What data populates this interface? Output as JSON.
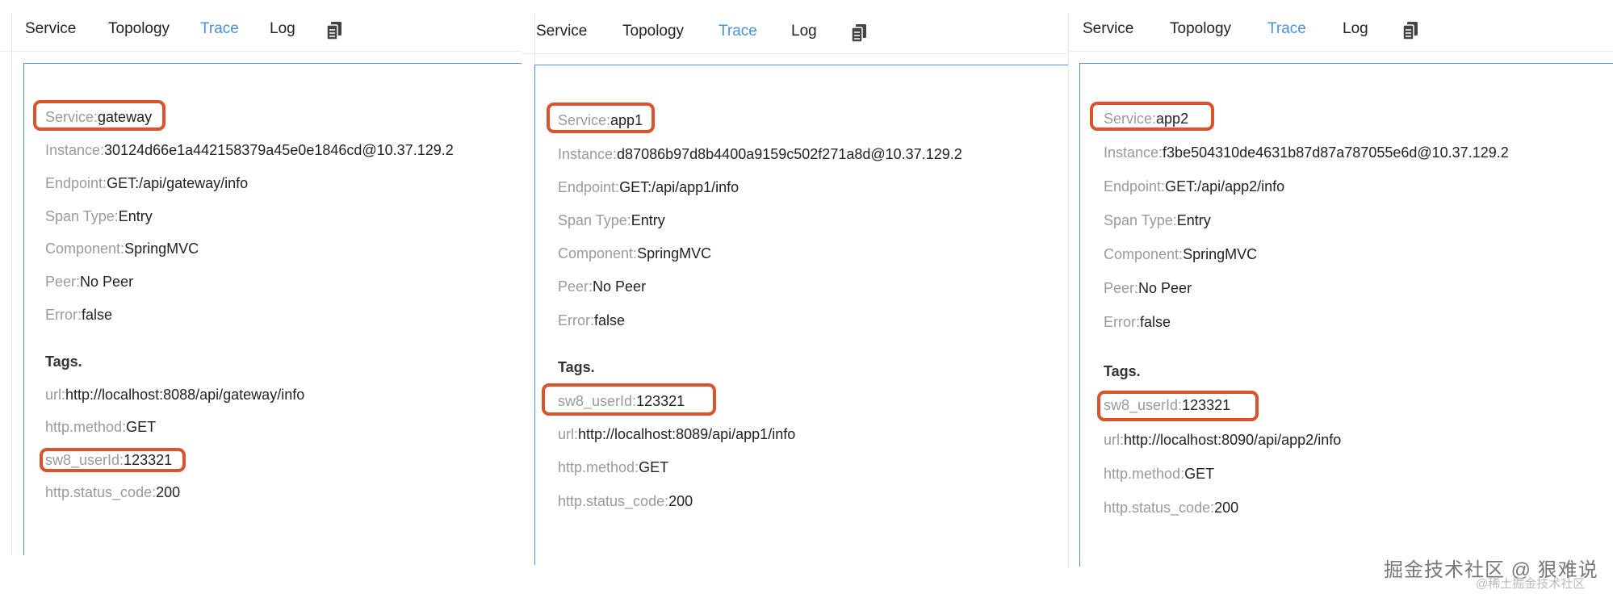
{
  "tabs": [
    "Service",
    "Topology",
    "Trace",
    "Log"
  ],
  "active_tab": "Trace",
  "tags_heading": "Tags.",
  "panels": [
    {
      "service": {
        "key": "Service:",
        "value": "gateway"
      },
      "instance": {
        "key": "Instance:",
        "value": "30124d66e1a442158379a45e0e1846cd@10.37.129.2"
      },
      "endpoint": {
        "key": "Endpoint:",
        "value": "GET:/api/gateway/info"
      },
      "span_type": {
        "key": "Span Type:",
        "value": "Entry"
      },
      "component": {
        "key": "Component:",
        "value": "SpringMVC"
      },
      "peer": {
        "key": "Peer:",
        "value": "No Peer"
      },
      "error": {
        "key": "Error:",
        "value": "false"
      },
      "tags": [
        {
          "key": "url:",
          "value": "http://localhost:8088/api/gateway/info"
        },
        {
          "key": "http.method:",
          "value": "GET"
        },
        {
          "key": "sw8_userId:",
          "value": "123321"
        },
        {
          "key": "http.status_code:",
          "value": "200"
        }
      ]
    },
    {
      "service": {
        "key": "Service:",
        "value": "app1"
      },
      "instance": {
        "key": "Instance:",
        "value": "d87086b97d8b4400a9159c502f271a8d@10.37.129.2"
      },
      "endpoint": {
        "key": "Endpoint:",
        "value": "GET:/api/app1/info"
      },
      "span_type": {
        "key": "Span Type:",
        "value": "Entry"
      },
      "component": {
        "key": "Component:",
        "value": "SpringMVC"
      },
      "peer": {
        "key": "Peer:",
        "value": "No Peer"
      },
      "error": {
        "key": "Error:",
        "value": "false"
      },
      "tags": [
        {
          "key": "sw8_userId:",
          "value": "123321"
        },
        {
          "key": "url:",
          "value": "http://localhost:8089/api/app1/info"
        },
        {
          "key": "http.method:",
          "value": "GET"
        },
        {
          "key": "http.status_code:",
          "value": "200"
        }
      ]
    },
    {
      "service": {
        "key": "Service:",
        "value": "app2"
      },
      "instance": {
        "key": "Instance:",
        "value": "f3be504310de4631b87d87a787055e6d@10.37.129.2"
      },
      "endpoint": {
        "key": "Endpoint:",
        "value": "GET:/api/app2/info"
      },
      "span_type": {
        "key": "Span Type:",
        "value": "Entry"
      },
      "component": {
        "key": "Component:",
        "value": "SpringMVC"
      },
      "peer": {
        "key": "Peer:",
        "value": "No Peer"
      },
      "error": {
        "key": "Error:",
        "value": "false"
      },
      "tags": [
        {
          "key": "sw8_userId:",
          "value": "123321"
        },
        {
          "key": "url:",
          "value": "http://localhost:8090/api/app2/info"
        },
        {
          "key": "http.method:",
          "value": "GET"
        },
        {
          "key": "http.status_code:",
          "value": "200"
        }
      ]
    }
  ],
  "highlight_color": "#d9532c",
  "accent_color": "#4a90d9",
  "icons": {
    "tab_extra": "copy-document-icon"
  },
  "watermark": {
    "main": "掘金技术社区 @ 狠难说",
    "sub": "@稀土掘金技术社区"
  }
}
